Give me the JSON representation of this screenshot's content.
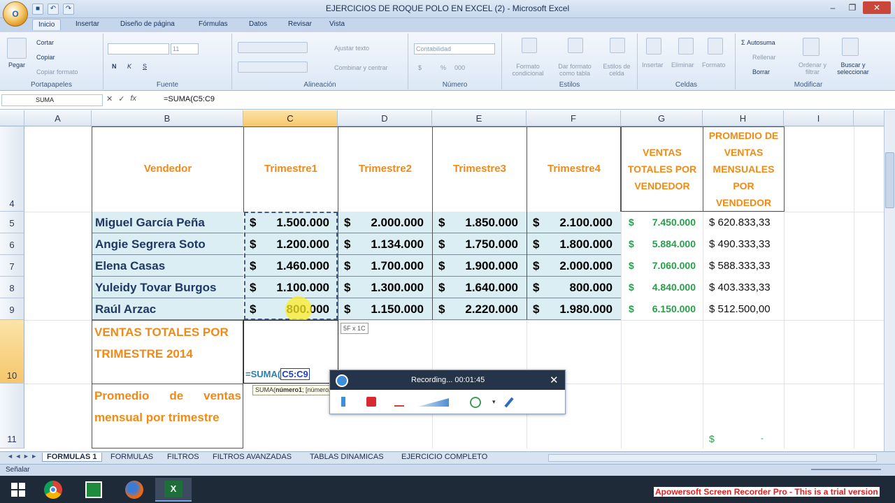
{
  "window": {
    "title": "EJERCICIOS  DE ROQUE POLO EN  EXCEL (2) - Microsoft Excel",
    "office_button": "O"
  },
  "ribbon": {
    "tabs": [
      "Inicio",
      "Insertar",
      "Diseño de página",
      "Fórmulas",
      "Datos",
      "Revisar",
      "Vista"
    ],
    "groups": {
      "portapapeles": {
        "label": "Portapapeles",
        "paste": "Pegar",
        "cut": "Cortar",
        "copy": "Copiar",
        "format_painter": "Copiar formato"
      },
      "fuente": {
        "label": "Fuente",
        "font_size": "11",
        "bold": "N",
        "italic": "K",
        "underline": "S"
      },
      "alineacion": {
        "label": "Alineación",
        "wrap": "Ajustar texto",
        "merge": "Combinar y centrar"
      },
      "numero": {
        "label": "Número",
        "format": "Contabilidad",
        "currency": "$",
        "percent": "%",
        "thousands": "000"
      },
      "estilos": {
        "label": "Estilos",
        "cond": "Formato condicional",
        "table": "Dar formato como tabla",
        "cell": "Estilos de celda"
      },
      "celdas": {
        "label": "Celdas",
        "insert": "Insertar",
        "delete": "Eliminar",
        "format": "Formato"
      },
      "modificar": {
        "label": "Modificar",
        "autosum": "Autosuma",
        "fill": "Rellenar",
        "clear": "Borrar",
        "sort": "Ordenar y filtrar",
        "find": "Buscar y seleccionar"
      }
    }
  },
  "formula_bar": {
    "name_box": "SUMA",
    "formula": "=SUMA(C5:C9",
    "cancel": "✕",
    "enter": "✓",
    "fx": "fx"
  },
  "columns": [
    "A",
    "B",
    "C",
    "D",
    "E",
    "F",
    "G",
    "H",
    "I"
  ],
  "rows": [
    "4",
    "5",
    "6",
    "7",
    "8",
    "9",
    "10",
    "11"
  ],
  "sheet": {
    "headers": {
      "vendedor": "Vendedor",
      "t1": "Trimestre1",
      "t2": "Trimestre2",
      "t3": "Trimestre3",
      "t4": "Trimestre4",
      "ventas_totales": "VENTAS TOTALES POR VENDEDOR",
      "promedio": "PROMEDIO DE VENTAS MENSUALES POR VENDEDOR"
    },
    "data_rows": [
      {
        "name": "Miguel García Peña",
        "t1": "1.500.000",
        "t2": "2.000.000",
        "t3": "1.850.000",
        "t4": "2.100.000",
        "total": "7.450.000",
        "avg": "$ 620.833,33"
      },
      {
        "name": "Angie Segrera Soto",
        "t1": "1.200.000",
        "t2": "1.134.000",
        "t3": "1.750.000",
        "t4": "1.800.000",
        "total": "5.884.000",
        "avg": "$ 490.333,33"
      },
      {
        "name": "Elena Casas",
        "t1": "1.460.000",
        "t2": "1.700.000",
        "t3": "1.900.000",
        "t4": "2.000.000",
        "total": "7.060.000",
        "avg": "$ 588.333,33"
      },
      {
        "name": "Yuleidy Tovar Burgos",
        "t1": "1.100.000",
        "t2": "1.300.000",
        "t3": "1.640.000",
        "t4": "800.000",
        "total": "4.840.000",
        "avg": "$ 403.333,33"
      },
      {
        "name": "Raúl Arzac",
        "t1": "800.000",
        "t2": "1.150.000",
        "t3": "2.220.000",
        "t4": "1.980.000",
        "total": "6.150.000",
        "avg": "$ 512.500,00"
      }
    ],
    "currency_symbol": "$",
    "row10_label": "VENTAS TOTALES POR TRIMESTRE 2014",
    "row11_label": "Promedio de ventas mensual por trimestre",
    "editing_formula_prefix": "=SUMA(",
    "editing_formula_ref": "C5:C9",
    "range_tip": "5F x 1C",
    "function_tip_name": "SUMA(",
    "function_tip_arg1": "número1",
    "function_tip_rest": "; [número2]; ...)",
    "h11_value": "$",
    "h11_dash": "-"
  },
  "sheet_tabs": [
    "FORMULAS 1",
    "FORMULAS",
    "FILTROS",
    "FILTROS AVANZADAS",
    "TABLAS DINAMICAS",
    "EJERCICIO COMPLETO"
  ],
  "status": {
    "mode": "Señalar"
  },
  "recorder": {
    "status": "Recording... 00:01:45",
    "close": "✕"
  },
  "watermark": "Apowersoft Screen Recorder Pro - This is a trial version",
  "colors": {
    "orange": "#f08a17",
    "green": "#27a04a",
    "navy": "#1f3864",
    "cell_fill": "#daeef3"
  }
}
